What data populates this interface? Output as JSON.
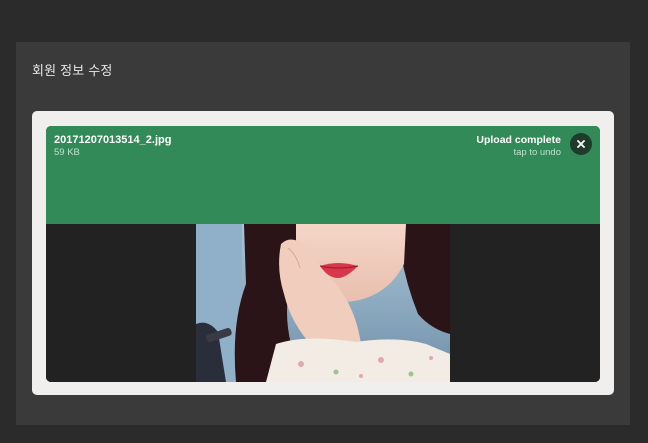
{
  "modal": {
    "title": "회원 정보 수정"
  },
  "upload": {
    "file_name": "20171207013514_2.jpg",
    "file_size": "59 KB",
    "status": "Upload complete",
    "action_hint": "tap to undo",
    "undo_icon": "close-icon"
  },
  "colors": {
    "success": "#318a57",
    "panel": "#f0efed",
    "modal": "#3a3a3a",
    "backdrop": "#2b2b2b"
  }
}
